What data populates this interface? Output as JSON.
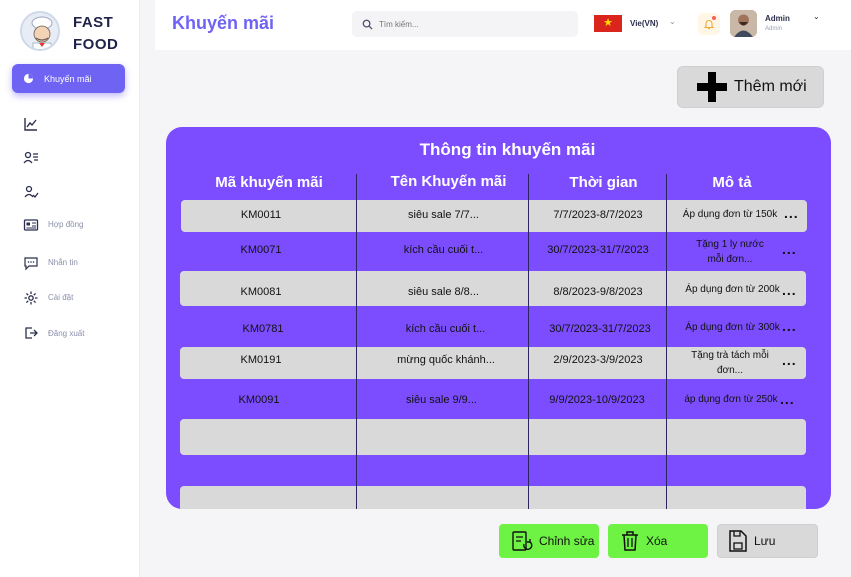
{
  "brand": {
    "line1": "FAST",
    "line2": "FOOD"
  },
  "sidebar": {
    "active_label": "Khuyến mãi",
    "items": [
      {
        "label": "",
        "icon": "chart-line-icon"
      },
      {
        "label": "",
        "icon": "user-list-icon"
      },
      {
        "label": "",
        "icon": "user-check-icon"
      },
      {
        "label": "Hợp đồng",
        "icon": "contract-card-icon"
      },
      {
        "label": "Nhắn tin",
        "icon": "message-icon"
      },
      {
        "label": "Cài đặt",
        "icon": "gear-icon"
      },
      {
        "label": "Đăng xuất",
        "icon": "logout-icon"
      }
    ]
  },
  "header": {
    "title": "Khuyến mãi",
    "search_placeholder": "Tìm kiếm...",
    "language": "Vie(VN)",
    "user_name": "Admin",
    "user_role": "Admin"
  },
  "actions": {
    "add_label": "Thêm mới",
    "edit_label": "Chỉnh sửa",
    "delete_label": "Xóa",
    "save_label": "Lưu"
  },
  "table": {
    "title": "Thông tin khuyến mãi",
    "columns": [
      "Mã khuyến mãi",
      "Tên Khuyến mãi",
      "Thời gian",
      "Mô tả"
    ],
    "rows": [
      {
        "code": "KM0011",
        "name": "siêu sale 7/7...",
        "time": "7/7/2023-8/7/2023",
        "desc": "Áp dụng đơn từ 150k",
        "desc2": ""
      },
      {
        "code": "KM0071",
        "name": "kích cầu cuối t...",
        "time": "30/7/2023-31/7/2023",
        "desc": "Tặng 1 ly nước",
        "desc2": "mỗi đơn..."
      },
      {
        "code": "KM0081",
        "name": "siêu sale 8/8...",
        "time": "8/8/2023-9/8/2023",
        "desc": "Áp dụng đơn từ 200k",
        "desc2": ""
      },
      {
        "code": "KM0781",
        "name": "kích cầu cuối t...",
        "time": "30/7/2023-31/7/2023",
        "desc": "Áp dụng đơn từ 300k",
        "desc2": ""
      },
      {
        "code": "KM0191",
        "name": "mừng quốc khánh...",
        "time": "2/9/2023-3/9/2023",
        "desc": "Tặng trà tách mỗi",
        "desc2": "đơn..."
      },
      {
        "code": "KM0091",
        "name": "siêu sale 9/9...",
        "time": "9/9/2023-10/9/2023",
        "desc": "áp dụng đơn từ 250k",
        "desc2": ""
      }
    ],
    "more_symbol": "..."
  },
  "colors": {
    "accent": "#6f63f4",
    "panel": "#7c4dff",
    "row": "#d9d9d9",
    "green": "#6ef244"
  }
}
